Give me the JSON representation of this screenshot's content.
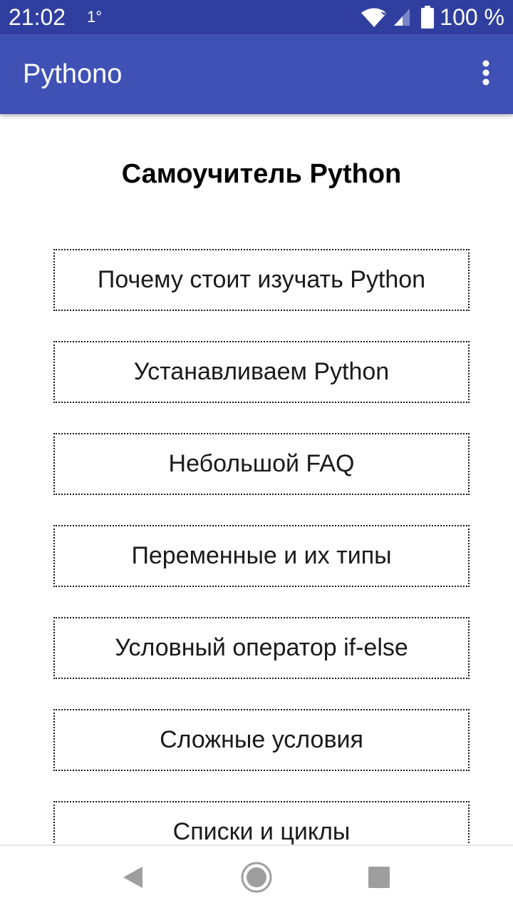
{
  "status_bar": {
    "time": "21:02",
    "notification": "1°",
    "battery": "100 %",
    "icons": [
      "wifi-icon",
      "signal-icon",
      "battery-icon"
    ]
  },
  "app_bar": {
    "title": "Pythono",
    "menu_icon": "more-vert-icon"
  },
  "main": {
    "title": "Самоучитель Python",
    "items": [
      {
        "label": "Почему стоит изучать Python"
      },
      {
        "label": "Устанавливаем Python"
      },
      {
        "label": "Небольшой FAQ"
      },
      {
        "label": "Переменные и их типы"
      },
      {
        "label": "Условный оператор if-else"
      },
      {
        "label": "Сложные условия"
      },
      {
        "label": "Списки и циклы"
      }
    ]
  },
  "nav_bar": {
    "icons": [
      "back-icon",
      "home-icon",
      "recents-icon"
    ]
  },
  "colors": {
    "status_bar": "#303f9f",
    "app_bar": "#3f51b5",
    "text": "#1a1a1a",
    "nav_icon": "#9e9e9e"
  }
}
